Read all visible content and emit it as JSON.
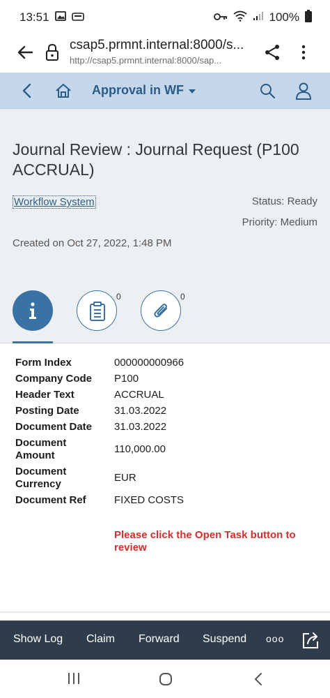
{
  "status_bar": {
    "time": "13:51",
    "battery": "100%"
  },
  "browser": {
    "host_url": "csap5.prmnt.internal:8000/s...",
    "full_url": "http://csap5.prmnt.internal:8000/sap..."
  },
  "shell": {
    "title": "Approval in WF"
  },
  "header": {
    "title": "Journal Review : Journal Request (P100 ACCRUAL)",
    "creator_link": "Workflow System",
    "status": "Status: Ready",
    "priority": "Priority: Medium",
    "created": "Created on Oct 27, 2022, 1:48 PM"
  },
  "tabs": {
    "notes_count": "0",
    "attachments_count": "0"
  },
  "form": {
    "rows": [
      {
        "label": "Form Index",
        "value": "000000000966"
      },
      {
        "label": "Company Code",
        "value": "P100"
      },
      {
        "label": "Header Text",
        "value": "ACCRUAL"
      },
      {
        "label": "Posting Date",
        "value": "31.03.2022"
      },
      {
        "label": "Document Date",
        "value": "31.03.2022"
      },
      {
        "label": "Document Amount",
        "value": "110,000.00"
      },
      {
        "label": "Document Currency",
        "value": "EUR"
      },
      {
        "label": "Document Ref",
        "value": "FIXED COSTS"
      }
    ],
    "notice": "Please click the Open Task button to review"
  },
  "toolbar": {
    "show_log": "Show Log",
    "claim": "Claim",
    "forward": "Forward",
    "suspend": "Suspend",
    "more": "ooo"
  },
  "colors": {
    "shell_bg": "#c5d7ea",
    "accent": "#3a72a5",
    "toolbar_bg": "#2f3c4b",
    "notice": "#d0312d"
  }
}
